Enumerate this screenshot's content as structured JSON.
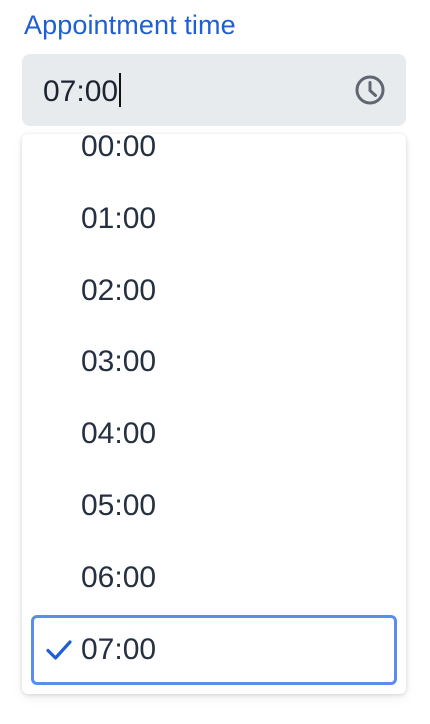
{
  "field": {
    "label": "Appointment time",
    "value": "07:00",
    "icon": "clock-icon"
  },
  "dropdown": {
    "options": [
      {
        "label": "00:00",
        "selected": false
      },
      {
        "label": "01:00",
        "selected": false
      },
      {
        "label": "02:00",
        "selected": false
      },
      {
        "label": "03:00",
        "selected": false
      },
      {
        "label": "04:00",
        "selected": false
      },
      {
        "label": "05:00",
        "selected": false
      },
      {
        "label": "06:00",
        "selected": false
      },
      {
        "label": "07:00",
        "selected": true
      }
    ],
    "selected_icon": "checkmark-icon"
  },
  "colors": {
    "accent": "#1f5fd6",
    "selected_border": "#5b8def",
    "input_bg": "#e8ebee",
    "text": "#253040"
  }
}
